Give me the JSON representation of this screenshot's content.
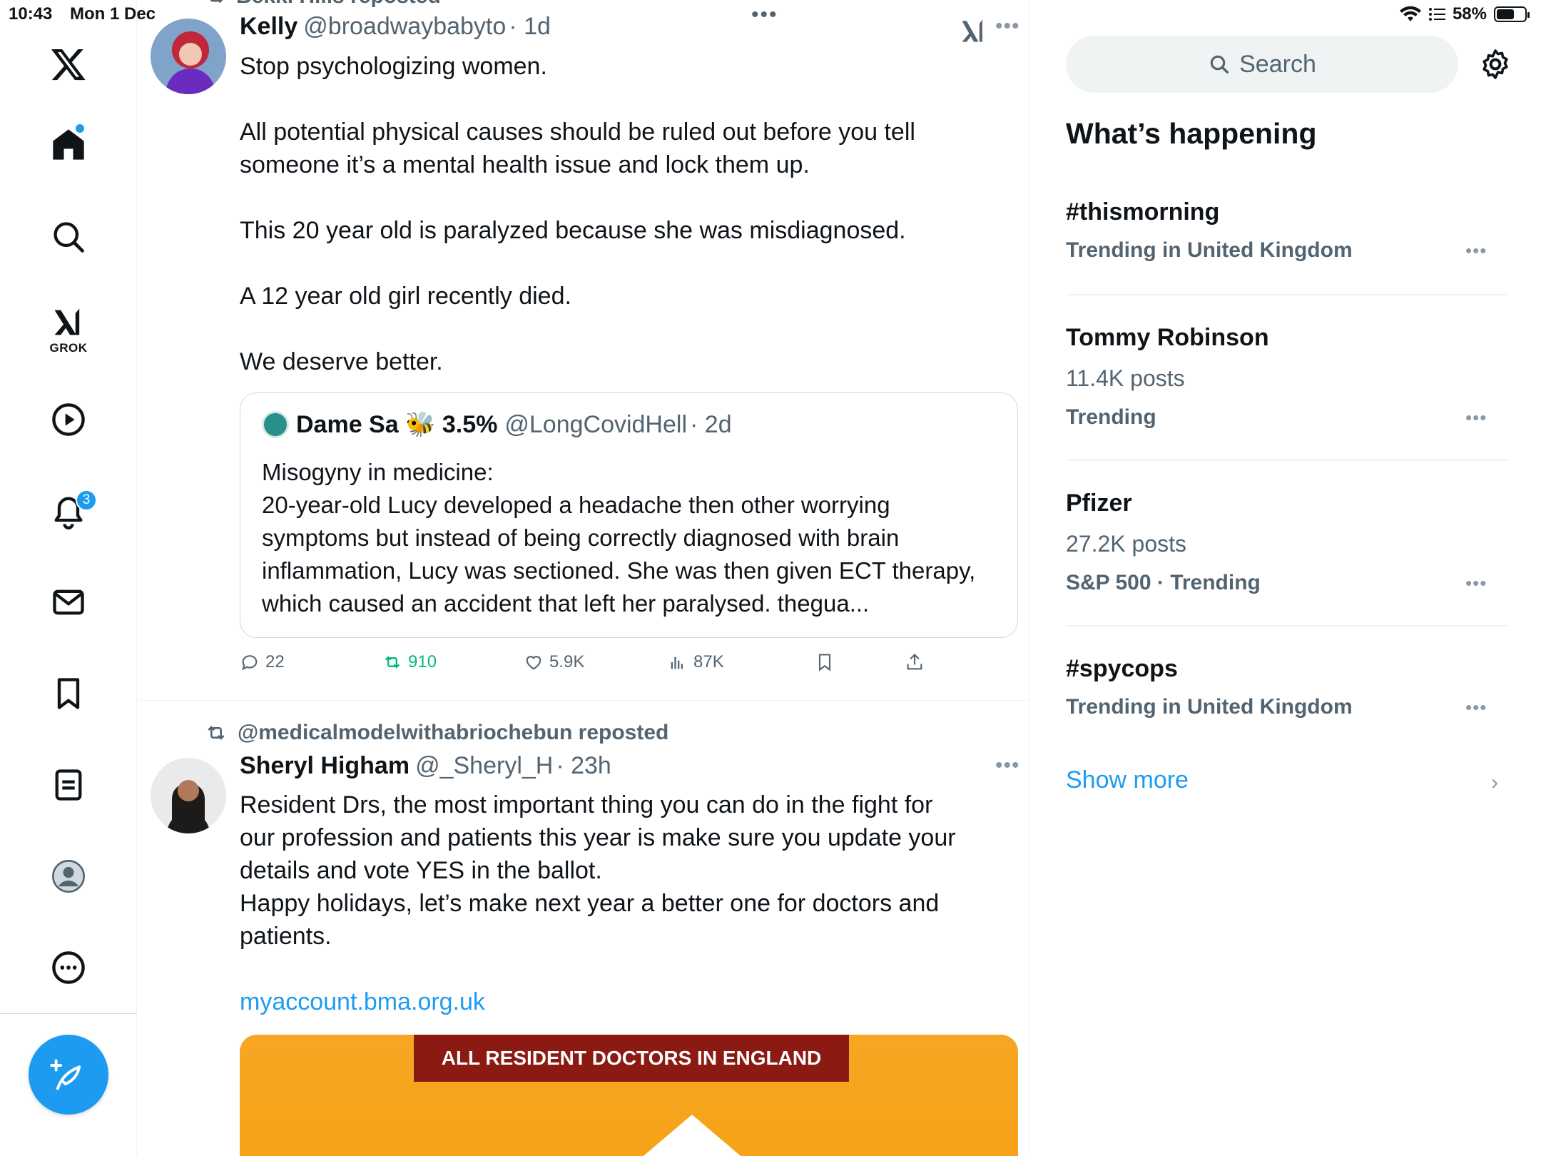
{
  "status_bar": {
    "time": "10:43",
    "date": "Mon 1 Dec",
    "battery": "58%"
  },
  "nav": {
    "grok_label": "GROK",
    "notifications_count": "3",
    "accent_color": "#1d9bf0"
  },
  "timeline": {
    "top_dots": "•••",
    "tweets": [
      {
        "reposted_by": "Bekki Hills reposted",
        "name": "Kelly",
        "handle": "@broadwaybabyto",
        "time": "· 1d",
        "body": [
          "Stop psychologizing women.",
          "",
          "All potential physical causes should be ruled out before you tell someone it’s a mental health issue and lock them up.",
          "",
          "This 20 year old is paralyzed because she was misdiagnosed.",
          "",
          "A 12 year old girl recently died.",
          "",
          "We deserve better."
        ],
        "quote": {
          "name": "Dame Sa 🐝 3.5%",
          "handle": "@LongCovidHell",
          "time": "· 2d",
          "text_1": "Misogyny in medicine:",
          "text_2": "20-year-old Lucy developed a headache then other worrying symptoms but instead of being correctly diagnosed with brain inflammation, Lucy was sectioned. She was then given ECT therapy, which caused an accident that left her paralysed. thegua..."
        },
        "stats": {
          "replies": "22",
          "reposts": "910",
          "likes": "5.9K",
          "views": "87K"
        }
      },
      {
        "reposted_by": "@medicalmodelwithabriochebun reposted",
        "name": "Sheryl Higham",
        "handle": "@_Sheryl_H",
        "time": "· 23h",
        "body": [
          "Resident Drs, the most important thing you can do in the fight for our profession and patients this year is make sure you update your details and vote YES in the ballot.",
          "Happy holidays, let’s make next year a better one for doctors and patients."
        ],
        "link": "myaccount.bma.org.uk",
        "media_banner": "ALL RESIDENT DOCTORS IN ENGLAND"
      }
    ]
  },
  "right": {
    "search_placeholder": "Search",
    "section_title": "What’s happening",
    "trends": [
      {
        "name": "#thismorning",
        "posts": "",
        "meta": "Trending in United Kingdom"
      },
      {
        "name": "Tommy Robinson",
        "posts": "11.4K posts",
        "meta": "Trending"
      },
      {
        "name": "Pfizer",
        "posts": "27.2K posts",
        "meta": "S&P 500 · Trending"
      },
      {
        "name": "#spycops",
        "posts": "",
        "meta": "Trending in United Kingdom"
      }
    ],
    "show_more": "Show more"
  }
}
